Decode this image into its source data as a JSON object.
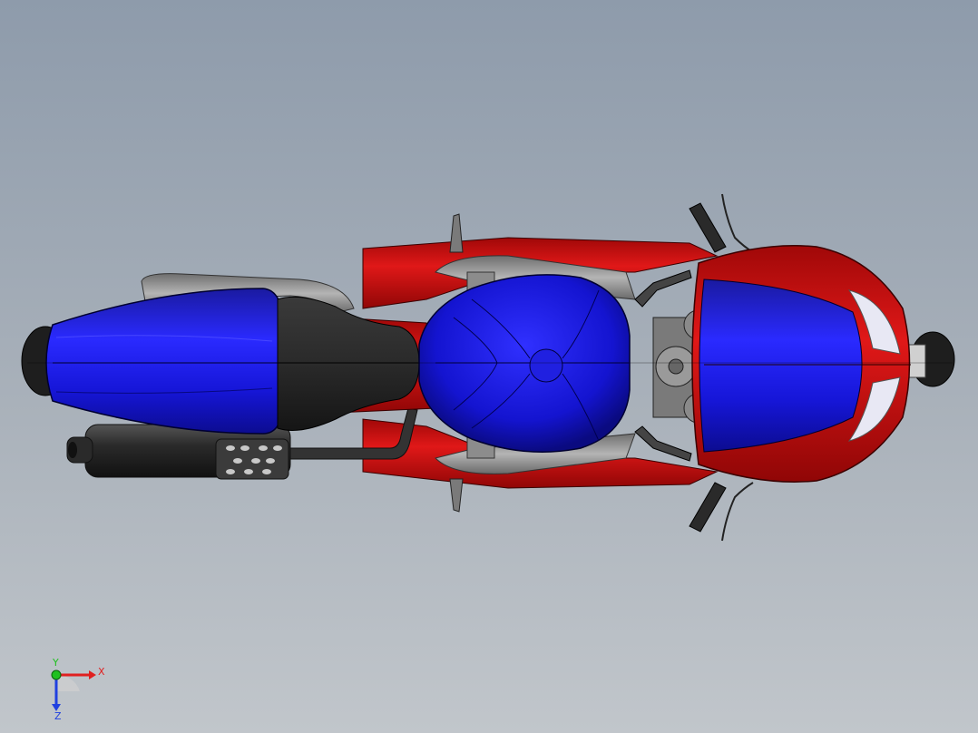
{
  "triad": {
    "x_label": "X",
    "y_label": "Y",
    "z_label": "Z"
  },
  "colors": {
    "viewport_top": "#8e9bab",
    "viewport_bottom": "#c1c6cb",
    "body_blue": "#1414c8",
    "fairing_red": "#c81010",
    "seat_black": "#2c2c2c",
    "frame_grey": "#8a8a8a",
    "axis_x": "#e02020",
    "axis_y": "#20c020",
    "axis_z": "#2040e0"
  },
  "model": {
    "view": "top",
    "icon": "motorcycle-model"
  }
}
